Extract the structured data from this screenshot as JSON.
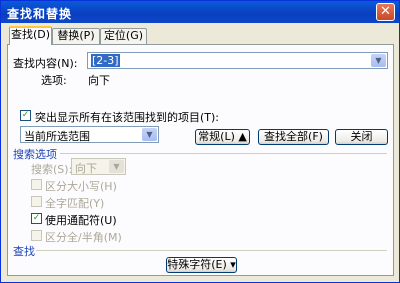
{
  "window": {
    "title": "查找和替换",
    "close_glyph": "✕"
  },
  "tabs": [
    {
      "label": "查找(D)"
    },
    {
      "label": "替换(P)"
    },
    {
      "label": "定位(G)"
    }
  ],
  "find": {
    "label": "查找内容(N):",
    "value": "[2-3]",
    "options_label": "选项:",
    "options_value": "向下"
  },
  "highlight": {
    "checkbox_label": "突出显示所有在该范围找到的项目(T):",
    "checked": true,
    "scope_value": "当前所选范围"
  },
  "buttons": {
    "more": "常规(L) ▲",
    "find_all": "查找全部(F)",
    "close": "关闭"
  },
  "search_options": {
    "group_label": "搜索选项",
    "direction_label": "搜索(S):",
    "direction_value": "向下",
    "checkboxes": [
      {
        "label": "区分大小写(H)",
        "checked": false,
        "enabled": false
      },
      {
        "label": "全字匹配(Y)",
        "checked": false,
        "enabled": false
      },
      {
        "label": "使用通配符(U)",
        "checked": true,
        "enabled": true
      },
      {
        "label": "区分全/半角(M)",
        "checked": false,
        "enabled": false
      }
    ]
  },
  "find_section": {
    "label": "查找",
    "special_button": "特殊字符(E) ▾"
  },
  "check_glyph": "✓"
}
